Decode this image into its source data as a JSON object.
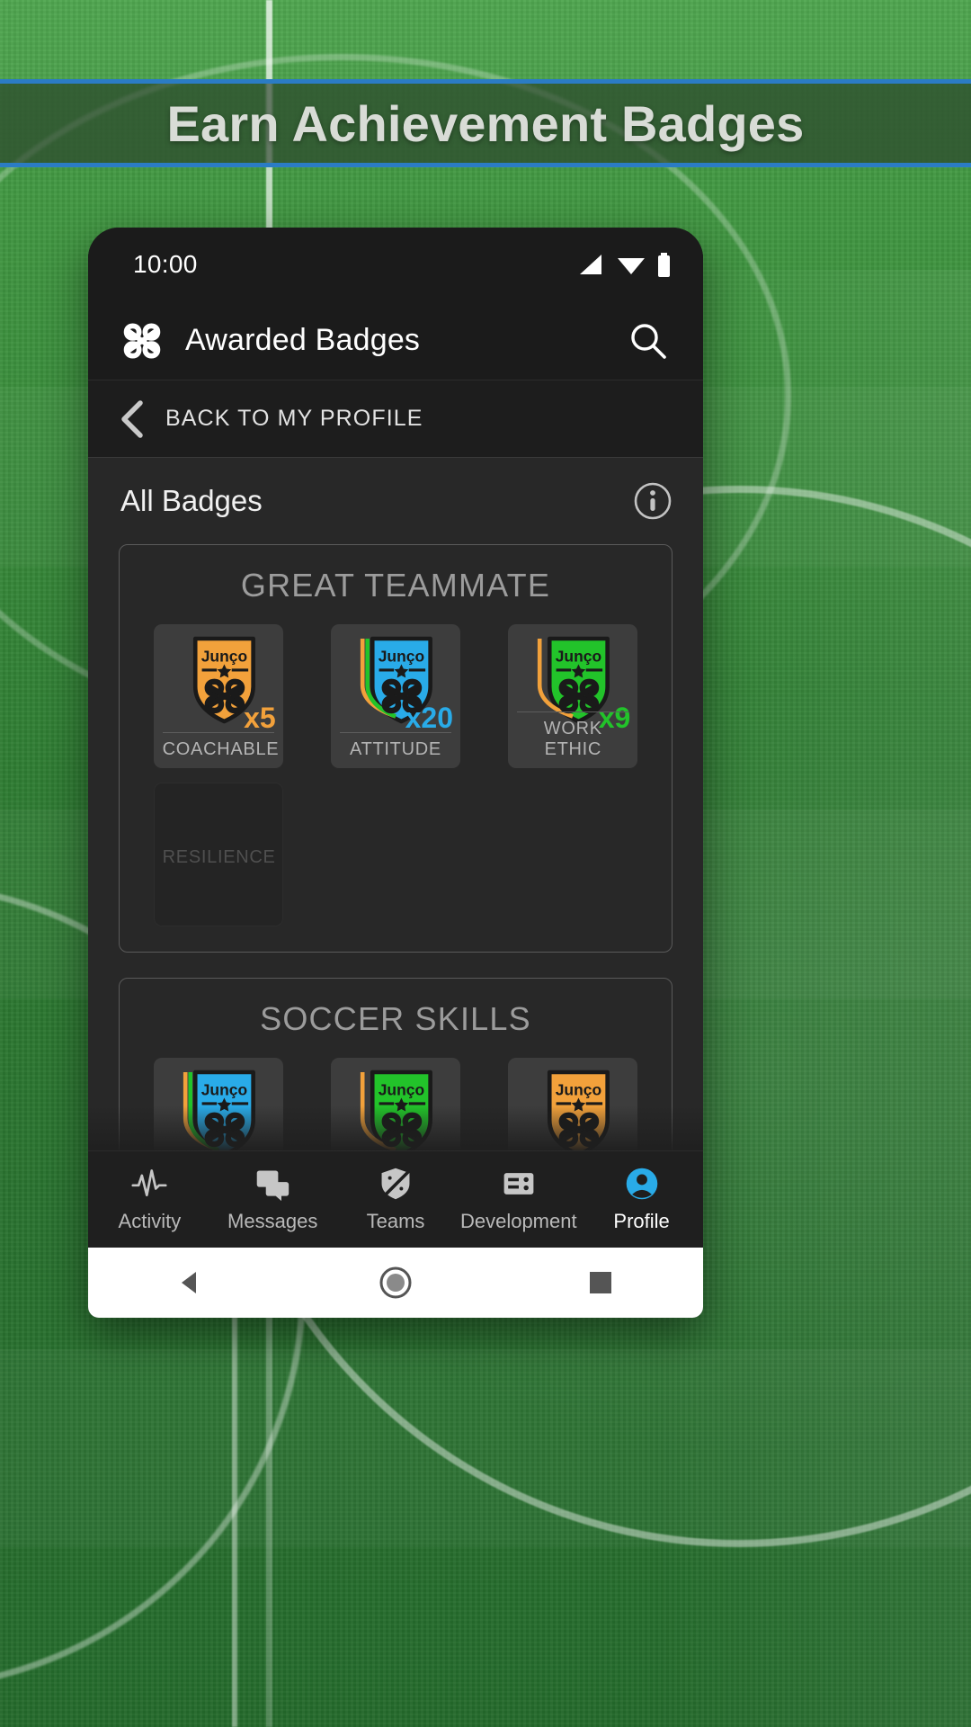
{
  "banner": {
    "headline": "Earn Achievement Badges",
    "border_color": "#2b7cc4"
  },
  "phone": {
    "status_bar": {
      "time": "10:00",
      "icons": [
        "signal-icon",
        "wifi-icon",
        "battery-icon"
      ]
    },
    "app_bar": {
      "logo": "junco-knot-logo",
      "title": "Awarded Badges",
      "search": "search-icon"
    },
    "back_bar": {
      "chevron": "chevron-left-icon",
      "label": "BACK TO MY PROFILE"
    },
    "section": {
      "title": "All Badges",
      "info": "info-icon"
    },
    "groups": [
      {
        "title": "GREAT TEAMMATE",
        "badges": [
          {
            "label": "COACHABLE",
            "count": "x5",
            "color": "#F2A13B",
            "accents": [],
            "locked": false
          },
          {
            "label": "ATTITUDE",
            "count": "x20",
            "color": "#29ABE8",
            "accents": [
              "#F2A13B",
              "#22C32A"
            ],
            "locked": false
          },
          {
            "label": "WORK ETHIC",
            "count": "x9",
            "color": "#22C32A",
            "accents": [
              "#F2A13B"
            ],
            "locked": false
          },
          {
            "label": "RESILIENCE",
            "count": "",
            "color": "",
            "accents": [],
            "locked": true
          }
        ]
      },
      {
        "title": "SOCCER SKILLS",
        "badges": [
          {
            "label": "",
            "count": "",
            "color": "#29ABE8",
            "accents": [
              "#F2A13B",
              "#22C32A"
            ],
            "locked": false
          },
          {
            "label": "",
            "count": "",
            "color": "#22C32A",
            "accents": [
              "#F2A13B"
            ],
            "locked": false
          },
          {
            "label": "",
            "count": "",
            "color": "#F2A13B",
            "accents": [],
            "locked": false
          }
        ]
      }
    ],
    "badge_crest_text": "Junço",
    "bottom_nav": {
      "items": [
        {
          "label": "Activity",
          "icon": "pulse-icon",
          "active": false
        },
        {
          "label": "Messages",
          "icon": "chat-icon",
          "active": false
        },
        {
          "label": "Teams",
          "icon": "shield-icon",
          "active": false
        },
        {
          "label": "Development",
          "icon": "dashboard-icon",
          "active": false
        },
        {
          "label": "Profile",
          "icon": "person-icon",
          "active": true
        }
      ],
      "active_color": "#29ABE8"
    },
    "system_nav": {
      "back": "triangle-back-icon",
      "home": "circle-home-icon",
      "recents": "square-recents-icon"
    }
  }
}
